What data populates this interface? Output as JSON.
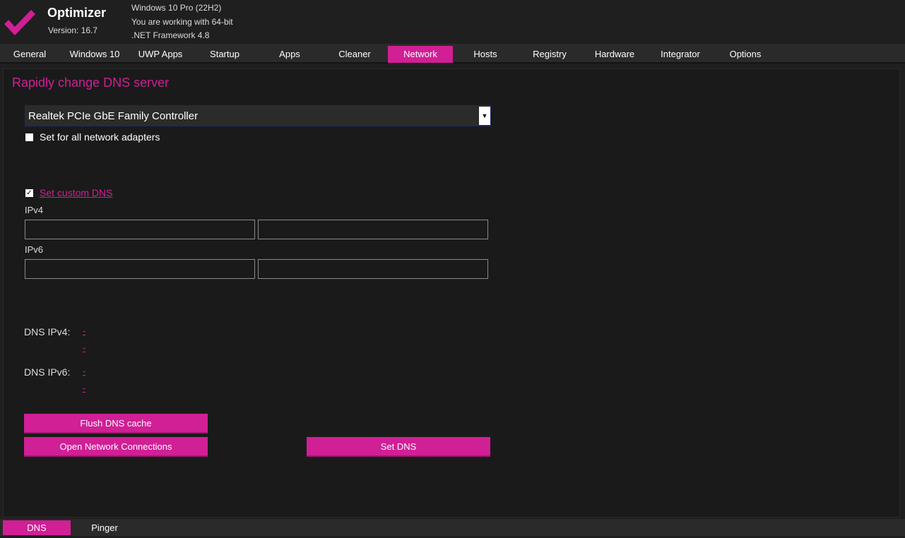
{
  "app": {
    "title": "Optimizer",
    "version": "Version: 16.7",
    "logo_icon": "checkmark-icon",
    "accent_color": "#d11f96"
  },
  "sysinfo": {
    "line1": "Windows 10 Pro (22H2)",
    "line2": "You are working with 64-bit",
    "line3": ".NET Framework 4.8"
  },
  "tabs": [
    {
      "label": "General"
    },
    {
      "label": "Windows 10"
    },
    {
      "label": "UWP Apps"
    },
    {
      "label": "Startup"
    },
    {
      "label": "Apps"
    },
    {
      "label": "Cleaner"
    },
    {
      "label": "Network",
      "active": true
    },
    {
      "label": "Hosts"
    },
    {
      "label": "Registry"
    },
    {
      "label": "Hardware"
    },
    {
      "label": "Integrator"
    },
    {
      "label": "Options"
    }
  ],
  "network": {
    "title": "Rapidly change DNS server",
    "adapter_selected": "Realtek PCIe GbE Family Controller",
    "set_all_label": "Set for all network adapters",
    "set_all_checked": false,
    "custom_dns_label": "Set custom DNS",
    "custom_dns_checked": true,
    "ipv4_label": "IPv4",
    "ipv6_label": "IPv6",
    "ipv4_primary": "",
    "ipv4_secondary": "",
    "ipv6_primary": "",
    "ipv6_secondary": "",
    "dns_ipv4_label": "DNS IPv4:",
    "dns_ipv6_label": "DNS IPv6:",
    "dns_ipv4_values": [
      "-",
      "-"
    ],
    "dns_ipv6_values": [
      "-",
      "-"
    ],
    "flush_button": "Flush DNS cache",
    "open_connections_button": "Open Network Connections",
    "set_dns_button": "Set DNS"
  },
  "subtabs": [
    {
      "label": "DNS",
      "active": true
    },
    {
      "label": "Pinger"
    }
  ]
}
